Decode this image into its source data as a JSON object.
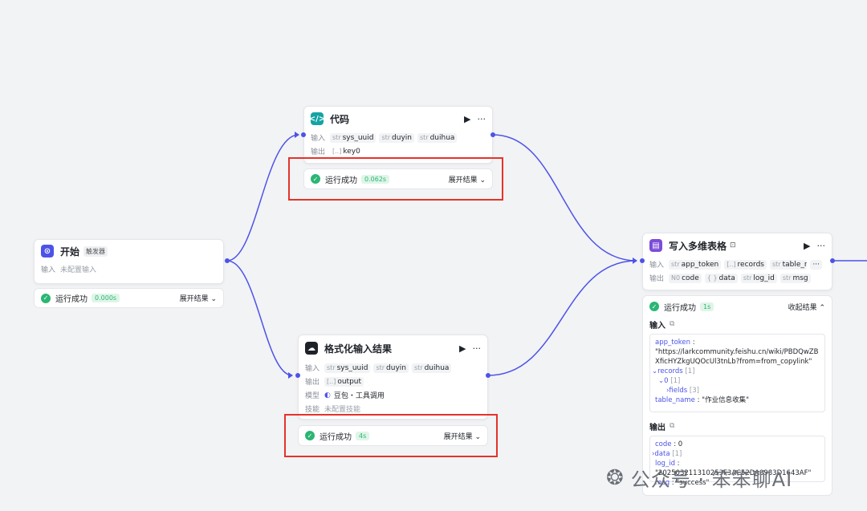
{
  "colors": {
    "edge": "#4d53e8",
    "success": "#2bb673",
    "highlight": "#e5332a"
  },
  "start_node": {
    "title": "开始",
    "badge": "触发器",
    "input_label": "输入",
    "input_value": "未配置输入",
    "status": "运行成功",
    "time": "0.000s",
    "expand": "展开结果"
  },
  "code_node": {
    "title": "代码",
    "input_label": "输入",
    "inputs": [
      {
        "type": "str",
        "name": "sys_uuid"
      },
      {
        "type": "str",
        "name": "duyin"
      },
      {
        "type": "str",
        "name": "duihua"
      }
    ],
    "output_label": "输出",
    "outputs": [
      {
        "type": "[..]",
        "name": "key0"
      }
    ],
    "status": "运行成功",
    "time": "0.062s",
    "expand": "展开结果"
  },
  "format_node": {
    "title": "格式化输入结果",
    "input_label": "输入",
    "inputs": [
      {
        "type": "str",
        "name": "sys_uuid"
      },
      {
        "type": "str",
        "name": "duyin"
      },
      {
        "type": "str",
        "name": "duihua"
      }
    ],
    "output_label": "输出",
    "outputs": [
      {
        "type": "[..]",
        "name": "output"
      }
    ],
    "model_label": "模型",
    "model_value": "豆包・工具调用",
    "skill_label": "技能",
    "skill_value": "未配置技能",
    "status": "运行成功",
    "time": "4s",
    "expand": "展开结果"
  },
  "write_node": {
    "title": "写入多维表格",
    "input_label": "输入",
    "inputs": [
      {
        "type": "str",
        "name": "app_token"
      },
      {
        "type": "[..]",
        "name": "records"
      },
      {
        "type": "str",
        "name": "table_name"
      }
    ],
    "more": "···",
    "output_label": "输出",
    "outputs": [
      {
        "type": "N0",
        "name": "code"
      },
      {
        "type": "{ }",
        "name": "data"
      },
      {
        "type": "str",
        "name": "log_id"
      },
      {
        "type": "str",
        "name": "msg"
      }
    ],
    "status": "运行成功",
    "time": "1s",
    "collapse": "收起结果",
    "input_title": "输入",
    "output_title": "输出",
    "input_json": {
      "app_token_key": "app_token",
      "app_token_value": "\"https://larkcommunity.feishu.cn/wiki/PBDQwZBXficHYZkgUQOcUl3tnLb?from=from_copylink\"",
      "records_key": "records",
      "records_count": "[1]",
      "item0_key": "0",
      "item0_count": "[1]",
      "fields_key": "fields",
      "fields_count": "[3]",
      "table_name_key": "table_name",
      "table_name_value": "\"作业信息收集\""
    },
    "output_json": {
      "code_key": "code",
      "code_value": "0",
      "data_key": "data",
      "data_count": "[1]",
      "log_id_key": "log_id",
      "log_id_value": "\"202503211310253F3AC52DA0983D1643AF\"",
      "msg_key": "msg",
      "msg_value": "\"success\""
    }
  },
  "watermark": "公众号 · 笨笨聊AI"
}
